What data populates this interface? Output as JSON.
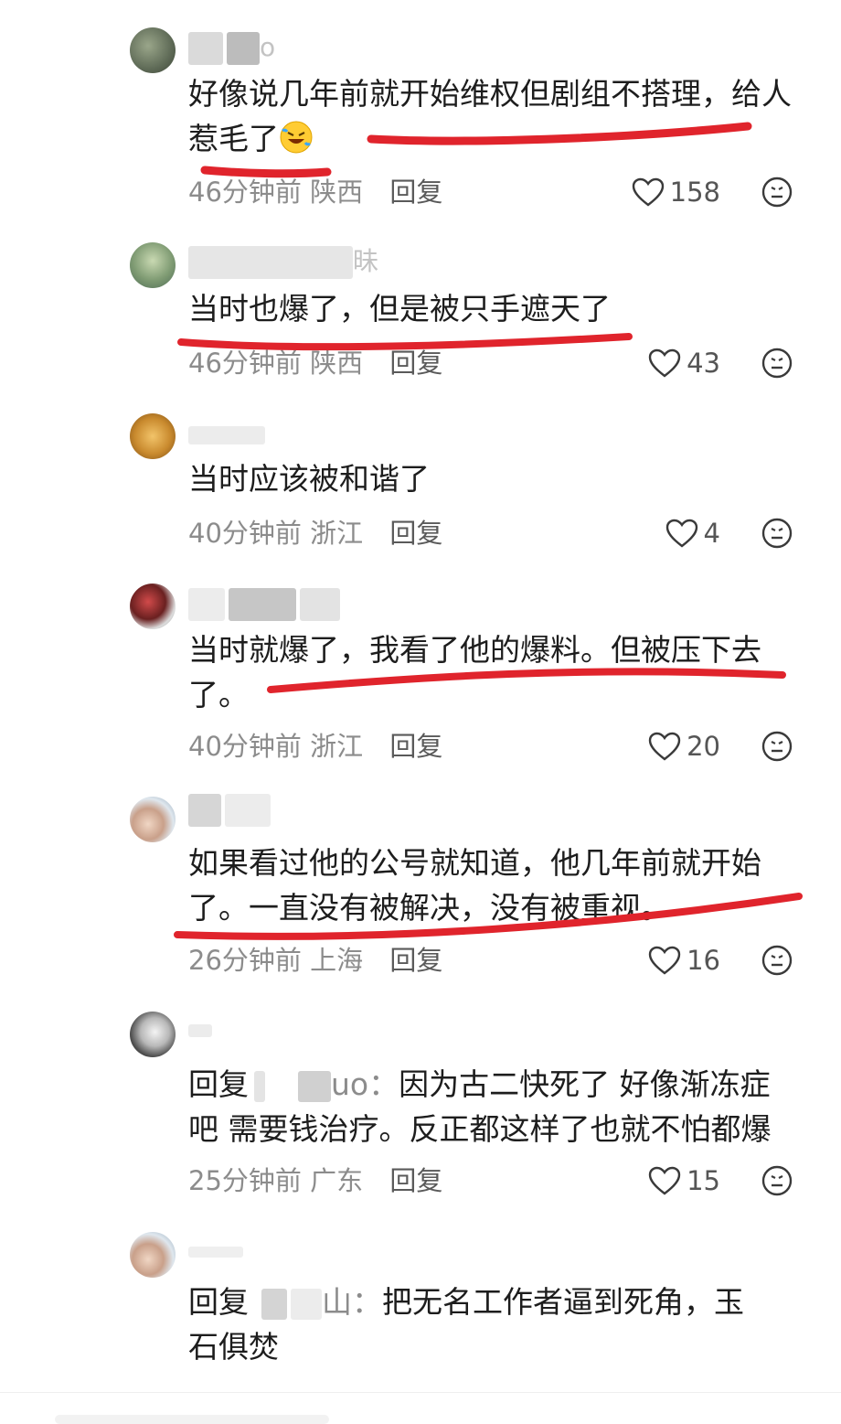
{
  "comments": [
    {
      "username": "o",
      "text": "好像说几年前就开始维权但剧组不搭理，给人惹毛了",
      "time": "46分钟前",
      "location": "陕西",
      "reply": "回复",
      "likes": "158"
    },
    {
      "username": "昧",
      "text": "当时也爆了，但是被只手遮天了",
      "time": "46分钟前",
      "location": "陕西",
      "reply": "回复",
      "likes": "43"
    },
    {
      "username": "",
      "text": "当时应该被和谐了",
      "time": "40分钟前",
      "location": "浙江",
      "reply": "回复",
      "likes": "4"
    },
    {
      "username": "",
      "text": "当时就爆了，我看了他的爆料。但被压下去了。",
      "time": "40分钟前",
      "location": "浙江",
      "reply": "回复",
      "likes": "20"
    },
    {
      "username": "",
      "text": "如果看过他的公号就知道，他几年前就开始了。一直没有被解决，没有被重视。",
      "time": "26分钟前",
      "location": "上海",
      "reply": "回复",
      "likes": "16"
    },
    {
      "username": "",
      "reply_prefix": "回复",
      "reply_to_suffix": "uo：",
      "text": "因为古二快死了 好像渐冻症",
      "text_line2": "吧 需要钱治疗。反正都这样了也就不怕都爆",
      "time": "25分钟前",
      "location": "广东",
      "reply": "回复",
      "likes": "15"
    },
    {
      "username": "",
      "reply_prefix": "回复",
      "reply_to_suffix": "山：",
      "text": "把无名工作者逼到死角，玉",
      "text_line2": "石俱焚"
    }
  ],
  "icons": {
    "like": "heart-outline-icon",
    "dislike": "neutral-face-icon",
    "emoji": "rolling-laughing-emoji"
  },
  "colors": {
    "annotation": "#e0242c",
    "meta": "#8c8c8c"
  }
}
